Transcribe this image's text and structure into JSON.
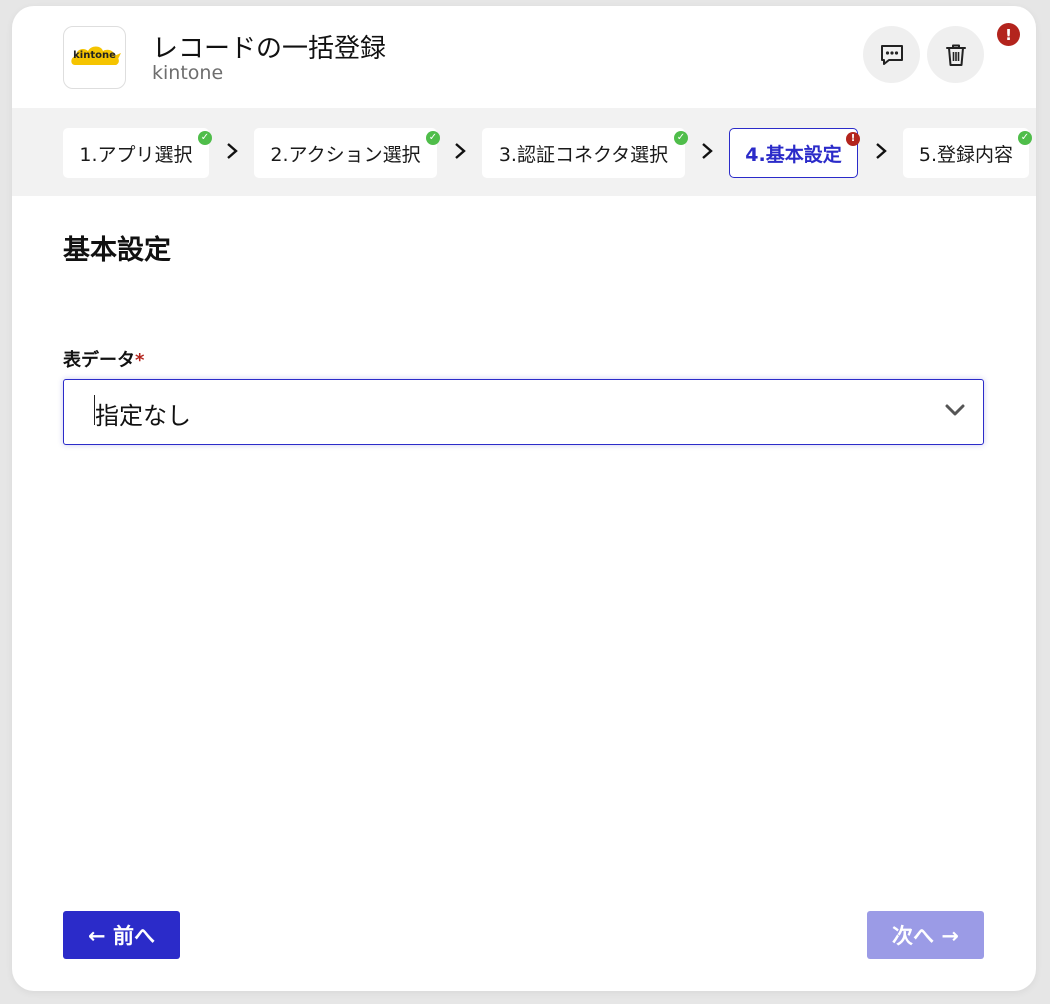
{
  "header": {
    "logo_text": "kintone",
    "title": "レコードの一括登録",
    "subtitle": "kintone",
    "error_badge": "!"
  },
  "steps": [
    {
      "label": "1.アプリ選択",
      "status": "ok",
      "badge": "✓"
    },
    {
      "label": "2.アクション選択",
      "status": "ok",
      "badge": "✓"
    },
    {
      "label": "3.認証コネクタ選択",
      "status": "ok",
      "badge": "✓"
    },
    {
      "label": "4.基本設定",
      "status": "error",
      "badge": "!",
      "active": true
    },
    {
      "label": "5.登録内容",
      "status": "ok",
      "badge": "✓"
    }
  ],
  "main": {
    "section_title": "基本設定",
    "field_label": "表データ",
    "required_mark": "*",
    "select_value": "指定なし"
  },
  "footer": {
    "prev_label": "← 前へ",
    "next_label": "次へ →"
  },
  "colors": {
    "accent": "#2b2bc9",
    "accent_disabled": "#9b9be6",
    "error": "#b3241d",
    "success": "#4fbd4a",
    "logo_yellow": "#f5c400"
  }
}
